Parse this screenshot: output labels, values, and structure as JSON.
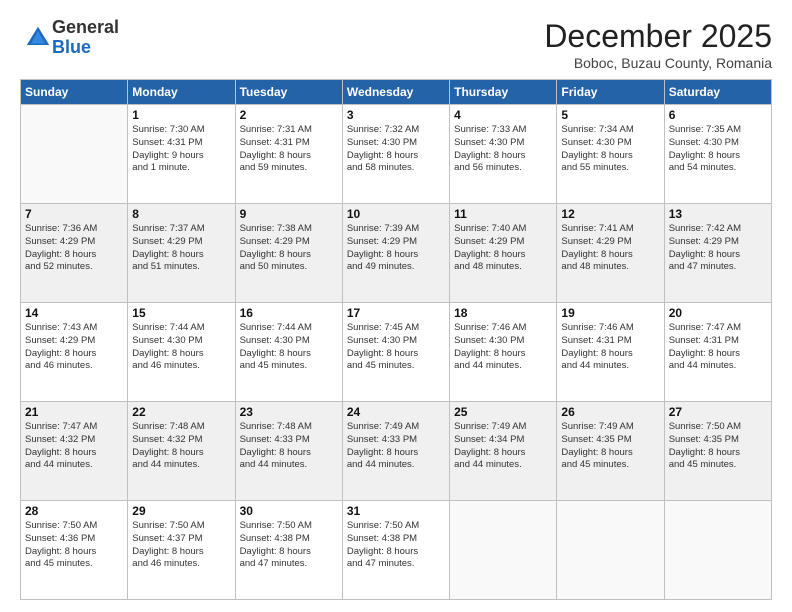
{
  "logo": {
    "general": "General",
    "blue": "Blue"
  },
  "header": {
    "month": "December 2025",
    "location": "Boboc, Buzau County, Romania"
  },
  "weekdays": [
    "Sunday",
    "Monday",
    "Tuesday",
    "Wednesday",
    "Thursday",
    "Friday",
    "Saturday"
  ],
  "weeks": [
    [
      {
        "day": "",
        "info": ""
      },
      {
        "day": "1",
        "info": "Sunrise: 7:30 AM\nSunset: 4:31 PM\nDaylight: 9 hours\nand 1 minute."
      },
      {
        "day": "2",
        "info": "Sunrise: 7:31 AM\nSunset: 4:31 PM\nDaylight: 8 hours\nand 59 minutes."
      },
      {
        "day": "3",
        "info": "Sunrise: 7:32 AM\nSunset: 4:30 PM\nDaylight: 8 hours\nand 58 minutes."
      },
      {
        "day": "4",
        "info": "Sunrise: 7:33 AM\nSunset: 4:30 PM\nDaylight: 8 hours\nand 56 minutes."
      },
      {
        "day": "5",
        "info": "Sunrise: 7:34 AM\nSunset: 4:30 PM\nDaylight: 8 hours\nand 55 minutes."
      },
      {
        "day": "6",
        "info": "Sunrise: 7:35 AM\nSunset: 4:30 PM\nDaylight: 8 hours\nand 54 minutes."
      }
    ],
    [
      {
        "day": "7",
        "info": "Sunrise: 7:36 AM\nSunset: 4:29 PM\nDaylight: 8 hours\nand 52 minutes."
      },
      {
        "day": "8",
        "info": "Sunrise: 7:37 AM\nSunset: 4:29 PM\nDaylight: 8 hours\nand 51 minutes."
      },
      {
        "day": "9",
        "info": "Sunrise: 7:38 AM\nSunset: 4:29 PM\nDaylight: 8 hours\nand 50 minutes."
      },
      {
        "day": "10",
        "info": "Sunrise: 7:39 AM\nSunset: 4:29 PM\nDaylight: 8 hours\nand 49 minutes."
      },
      {
        "day": "11",
        "info": "Sunrise: 7:40 AM\nSunset: 4:29 PM\nDaylight: 8 hours\nand 48 minutes."
      },
      {
        "day": "12",
        "info": "Sunrise: 7:41 AM\nSunset: 4:29 PM\nDaylight: 8 hours\nand 48 minutes."
      },
      {
        "day": "13",
        "info": "Sunrise: 7:42 AM\nSunset: 4:29 PM\nDaylight: 8 hours\nand 47 minutes."
      }
    ],
    [
      {
        "day": "14",
        "info": "Sunrise: 7:43 AM\nSunset: 4:29 PM\nDaylight: 8 hours\nand 46 minutes."
      },
      {
        "day": "15",
        "info": "Sunrise: 7:44 AM\nSunset: 4:30 PM\nDaylight: 8 hours\nand 46 minutes."
      },
      {
        "day": "16",
        "info": "Sunrise: 7:44 AM\nSunset: 4:30 PM\nDaylight: 8 hours\nand 45 minutes."
      },
      {
        "day": "17",
        "info": "Sunrise: 7:45 AM\nSunset: 4:30 PM\nDaylight: 8 hours\nand 45 minutes."
      },
      {
        "day": "18",
        "info": "Sunrise: 7:46 AM\nSunset: 4:30 PM\nDaylight: 8 hours\nand 44 minutes."
      },
      {
        "day": "19",
        "info": "Sunrise: 7:46 AM\nSunset: 4:31 PM\nDaylight: 8 hours\nand 44 minutes."
      },
      {
        "day": "20",
        "info": "Sunrise: 7:47 AM\nSunset: 4:31 PM\nDaylight: 8 hours\nand 44 minutes."
      }
    ],
    [
      {
        "day": "21",
        "info": "Sunrise: 7:47 AM\nSunset: 4:32 PM\nDaylight: 8 hours\nand 44 minutes."
      },
      {
        "day": "22",
        "info": "Sunrise: 7:48 AM\nSunset: 4:32 PM\nDaylight: 8 hours\nand 44 minutes."
      },
      {
        "day": "23",
        "info": "Sunrise: 7:48 AM\nSunset: 4:33 PM\nDaylight: 8 hours\nand 44 minutes."
      },
      {
        "day": "24",
        "info": "Sunrise: 7:49 AM\nSunset: 4:33 PM\nDaylight: 8 hours\nand 44 minutes."
      },
      {
        "day": "25",
        "info": "Sunrise: 7:49 AM\nSunset: 4:34 PM\nDaylight: 8 hours\nand 44 minutes."
      },
      {
        "day": "26",
        "info": "Sunrise: 7:49 AM\nSunset: 4:35 PM\nDaylight: 8 hours\nand 45 minutes."
      },
      {
        "day": "27",
        "info": "Sunrise: 7:50 AM\nSunset: 4:35 PM\nDaylight: 8 hours\nand 45 minutes."
      }
    ],
    [
      {
        "day": "28",
        "info": "Sunrise: 7:50 AM\nSunset: 4:36 PM\nDaylight: 8 hours\nand 45 minutes."
      },
      {
        "day": "29",
        "info": "Sunrise: 7:50 AM\nSunset: 4:37 PM\nDaylight: 8 hours\nand 46 minutes."
      },
      {
        "day": "30",
        "info": "Sunrise: 7:50 AM\nSunset: 4:38 PM\nDaylight: 8 hours\nand 47 minutes."
      },
      {
        "day": "31",
        "info": "Sunrise: 7:50 AM\nSunset: 4:38 PM\nDaylight: 8 hours\nand 47 minutes."
      },
      {
        "day": "",
        "info": ""
      },
      {
        "day": "",
        "info": ""
      },
      {
        "day": "",
        "info": ""
      }
    ]
  ]
}
